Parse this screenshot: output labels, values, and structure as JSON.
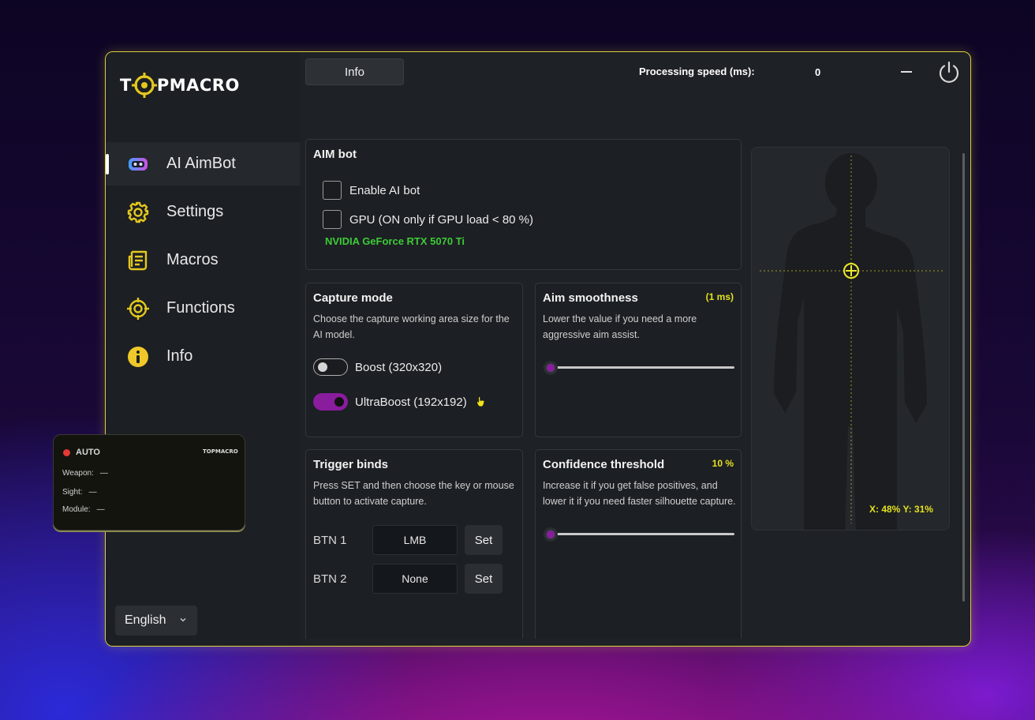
{
  "app": {
    "brand": {
      "prefix": "T",
      "suffix": "PMACRO"
    },
    "colors": {
      "accent": "#e3e01e",
      "toggle_on": "#8a1c9e",
      "gpu_text": "#3ecb38",
      "window_border": "#d9d23a"
    }
  },
  "topbar": {
    "info_tab": "Info",
    "speed_label": "Processing speed (ms):",
    "speed_value": "0",
    "minimize_icon": "minimize-icon",
    "power_icon": "power-icon"
  },
  "sidebar": {
    "items": [
      {
        "label": "AI AimBot",
        "icon": "robot-icon",
        "active": true
      },
      {
        "label": "Settings",
        "icon": "gear-icon",
        "active": false
      },
      {
        "label": "Macros",
        "icon": "document-icon",
        "active": false
      },
      {
        "label": "Functions",
        "icon": "crosshair-icon",
        "active": false
      },
      {
        "label": "Info",
        "icon": "info-icon",
        "active": false
      }
    ],
    "language": "English"
  },
  "aimbot": {
    "title": "AIM bot",
    "enable_label": "Enable AI bot",
    "gpu_label": "GPU (ON only if GPU load < 80 %)",
    "gpu_name": "NVIDIA GeForce RTX 5070 Ti"
  },
  "capture": {
    "title": "Capture mode",
    "desc": "Choose the capture working area size for the AI model.",
    "boost_label": "Boost (320x320)",
    "boost_on": false,
    "ultra_label": "UltraBoost (192x192)",
    "ultra_on": true
  },
  "smoothness": {
    "title": "Aim smoothness",
    "badge": "(1 ms)",
    "desc": "Lower the value if you need a more aggressive aim assist.",
    "value": 0
  },
  "triggers": {
    "title": "Trigger binds",
    "desc": "Press SET and then choose the key or mouse button to activate capture.",
    "binds": [
      {
        "label": "BTN 1",
        "value": "LMB",
        "set": "Set"
      },
      {
        "label": "BTN 2",
        "value": "None",
        "set": "Set"
      }
    ]
  },
  "confidence": {
    "title": "Confidence threshold",
    "badge": "10 %",
    "desc": "Increase it if you get false positives, and lower it if you need faster silhouette capture.",
    "value": 0
  },
  "preview": {
    "coords": "X: 48%  Y: 31%"
  },
  "overlay": {
    "status": "AUTO",
    "logo": "TOPMACRO",
    "weapon_label": "Weapon:",
    "weapon_value": "—",
    "sight_label": "Sight:",
    "sight_value": "—",
    "module_label": "Module:",
    "module_value": "—"
  }
}
